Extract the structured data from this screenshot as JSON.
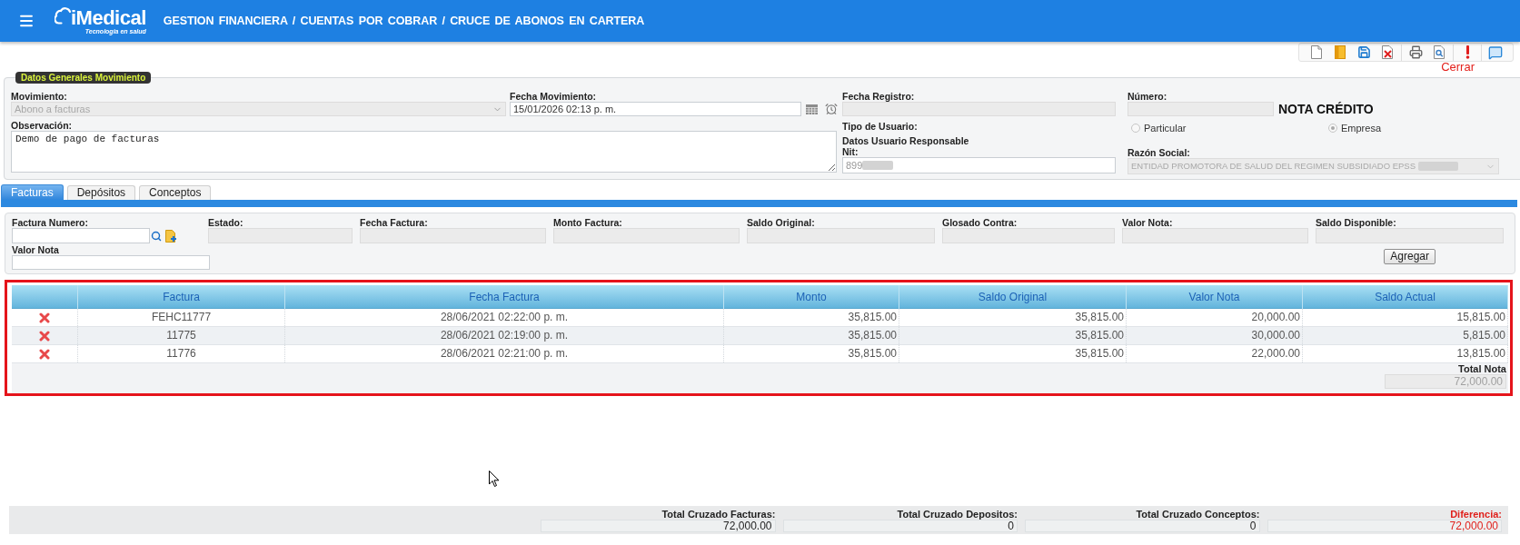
{
  "header": {
    "logo": {
      "name": "iMedical",
      "tagline": "Tecnologia en salud"
    },
    "breadcrumb": "GESTION FINANCIERA / CUENTAS POR COBRAR / CRUCE DE ABONOS EN CARTERA"
  },
  "toolbar": {
    "close_label": "Cerrar"
  },
  "general": {
    "legend": "Datos Generales Movimiento",
    "movimiento": {
      "label": "Movimiento:",
      "value": "Abono a facturas",
      "disabled": true
    },
    "fecha_movimiento": {
      "label": "Fecha Movimiento:",
      "value": "15/01/2026 02:13 p. m."
    },
    "fecha_registro": {
      "label": "Fecha Registro:",
      "disabled": true
    },
    "numero": {
      "label": "Número:",
      "disabled": true
    },
    "document_type": "NOTA CRÉDITO",
    "observacion": {
      "label": "Observación:",
      "value": "Demo de pago de facturas"
    },
    "tipo_usuario": {
      "label": "Tipo de Usuario:",
      "options": [
        {
          "label": "Particular",
          "selected": false
        },
        {
          "label": "Empresa",
          "selected": true
        }
      ]
    },
    "responsable_heading": "Datos Usuario Responsable",
    "nit": {
      "label": "Nit:",
      "value": "899",
      "redacted": true
    },
    "razon_social": {
      "label": "Razón Social:",
      "value": "ENTIDAD PROMOTORA DE SALUD DEL REGIMEN SUBSIDIADO EPSS",
      "disabled": true,
      "redacted": true
    }
  },
  "tabs": [
    {
      "label": "Facturas",
      "selected": true
    },
    {
      "label": "Depósitos",
      "selected": false
    },
    {
      "label": "Conceptos",
      "selected": false
    }
  ],
  "invoice_form": {
    "fields": [
      {
        "label": "Factura Numero:",
        "kind": "search",
        "disabled": false
      },
      {
        "label": "Estado:",
        "kind": "text",
        "disabled": true
      },
      {
        "label": "Fecha Factura:",
        "kind": "text",
        "disabled": true
      },
      {
        "label": "Monto Factura:",
        "kind": "text",
        "disabled": true
      },
      {
        "label": "Saldo Original:",
        "kind": "text",
        "disabled": true
      },
      {
        "label": "Glosado Contra:",
        "kind": "text",
        "disabled": true
      },
      {
        "label": "Valor Nota:",
        "kind": "text",
        "disabled": true
      },
      {
        "label": "Saldo Disponible:",
        "kind": "text",
        "disabled": true
      }
    ],
    "valor_nota": {
      "label": "Valor Nota",
      "disabled": false
    },
    "add_button": "Agregar"
  },
  "table": {
    "columns": [
      "Factura",
      "Fecha Factura",
      "Monto",
      "Saldo Original",
      "Valor Nota",
      "Saldo Actual"
    ],
    "rows": [
      {
        "cells": [
          "FEHC11777",
          "28/06/2021 02:22:00 p. m.",
          "35,815.00",
          "35,815.00",
          "20,000.00",
          "15,815.00"
        ]
      },
      {
        "cells": [
          "11775",
          "28/06/2021 02:19:00 p. m.",
          "35,815.00",
          "35,815.00",
          "30,000.00",
          "5,815.00"
        ]
      },
      {
        "cells": [
          "11776",
          "28/06/2021 02:21:00 p. m.",
          "35,815.00",
          "35,815.00",
          "22,000.00",
          "13,815.00"
        ]
      }
    ],
    "total": {
      "label": "Total Nota",
      "value": "72,000.00"
    }
  },
  "totals": [
    {
      "label": "Total Cruzado Facturas:",
      "value": "72,000.00",
      "kind": "plain"
    },
    {
      "label": "Total Cruzado Depositos:",
      "value": "0",
      "kind": "plain"
    },
    {
      "label": "Total Cruzado Conceptos:",
      "value": "0",
      "kind": "plain"
    },
    {
      "label": "Diferencia:",
      "value": "72,000.00",
      "kind": "alert"
    }
  ]
}
